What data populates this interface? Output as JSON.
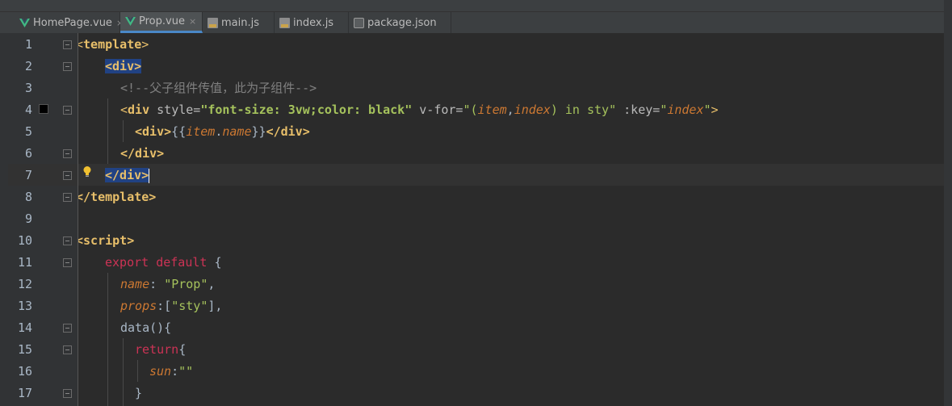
{
  "tabs": [
    {
      "label": "HomePage.vue",
      "icon": "vue-icon",
      "active": false,
      "closable": true
    },
    {
      "label": "Prop.vue",
      "icon": "vue-icon",
      "active": true,
      "closable": true
    },
    {
      "label": "main.js",
      "icon": "js-file-icon",
      "active": false,
      "closable": false
    },
    {
      "label": "index.js",
      "icon": "js-file-icon",
      "active": false,
      "closable": false
    },
    {
      "label": "package.json",
      "icon": "json-file-icon",
      "active": false,
      "closable": false
    }
  ],
  "close_glyph": "×",
  "line_numbers": [
    "1",
    "2",
    "3",
    "4",
    "5",
    "6",
    "7",
    "8",
    "9",
    "10",
    "11",
    "12",
    "13",
    "14",
    "15",
    "16",
    "17"
  ],
  "code": {
    "l1": {
      "open": "<",
      "tag": "template",
      "close": ">"
    },
    "l2": {
      "text": "<div>"
    },
    "l3": {
      "comment": "<!--父子组件传值，此为子组件-->"
    },
    "l4": {
      "lt": "<",
      "tag": "div",
      "attr_style": " style=",
      "style_val": "\"font-size: 3vw;color: black\"",
      "attr_vfor": " v-for=",
      "vfor_q1": "\"(",
      "vfor_item": "item",
      "vfor_comma": ",",
      "vfor_index": "index",
      "vfor_rest": ") in sty\"",
      "attr_key": " :key=",
      "key_q1": "\"",
      "key_index": "index",
      "key_q2": "\"",
      "gt": ">"
    },
    "l5": {
      "open": "<div>",
      "braces_open": "{{",
      "item": "item",
      "dot": ".",
      "name": "name",
      "braces_close": "}}",
      "close": "</div>"
    },
    "l6": {
      "text": "</div>"
    },
    "l7": {
      "text": "</div>"
    },
    "l8": {
      "text": "</template>"
    },
    "l10": {
      "text": "<script>"
    },
    "l11": {
      "kw1": "export",
      "kw2": " default",
      "brace": " {"
    },
    "l12": {
      "key": "name",
      "colon": ": ",
      "val": "\"Prop\"",
      "comma": ","
    },
    "l13": {
      "key": "props",
      "colon": ":[",
      "val": "\"sty\"",
      "rest": "],"
    },
    "l14": {
      "fn": "data",
      "rest": "(){"
    },
    "l15": {
      "kw": "return",
      "rest": "{"
    },
    "l16": {
      "key": "sun",
      "colon": ":",
      "val": "\"\""
    },
    "l17": {
      "text": "}"
    }
  },
  "colors": {
    "background": "#2b2b2b",
    "gutter": "#313335",
    "tab_bar": "#3c3f41",
    "active_tab_underline": "#4a88c7",
    "selection": "#214283",
    "tag": "#e8bf6a",
    "string": "#a5c25c",
    "keyword": "#cc7832",
    "property": "#9876aa",
    "comment": "#808080"
  }
}
